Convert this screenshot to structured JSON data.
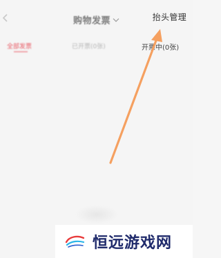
{
  "header": {
    "back_icon": "chevron-left-icon",
    "title": "购物发票",
    "title_icon": "chevron-down-icon",
    "action_label": "抬头管理"
  },
  "tabs": [
    {
      "label": "全部发票",
      "active": true
    },
    {
      "label": "已开票(0张)",
      "active": false
    },
    {
      "label": "开票中(0张)",
      "active": false
    }
  ],
  "annotation": {
    "type": "arrow",
    "color": "#f5a060",
    "points_to": "抬头管理"
  },
  "watermark": {
    "text": "恒远游戏网"
  },
  "colors": {
    "accent": "#e85a64",
    "arrow": "#f5a060",
    "watermark_text": "#1f2a6b"
  }
}
